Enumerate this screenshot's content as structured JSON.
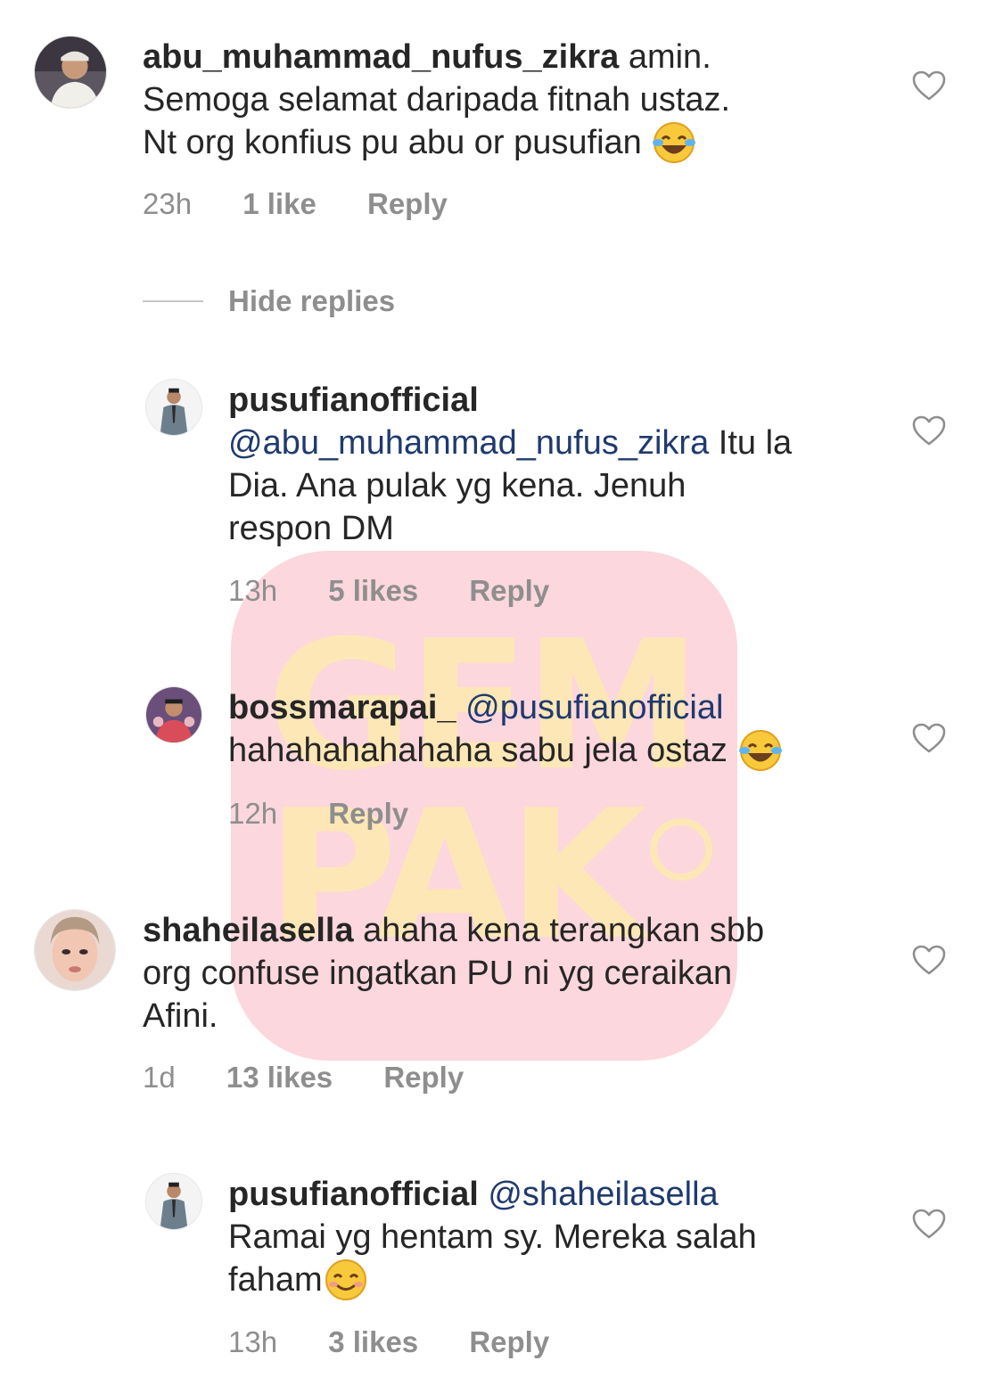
{
  "watermark": {
    "line1": "GEM",
    "line2": "PAK"
  },
  "comments": [
    {
      "username": "abu_muhammad_nufus_zikra",
      "text_line1": "amin.",
      "text_line2": "Semoga selamat daripada fitnah ustaz.",
      "text_line3": "Nt org konfius pu abu or pusufian",
      "emoji": "face-with-tears-of-joy",
      "time": "23h",
      "likes": "1 like",
      "reply_label": "Reply"
    },
    {
      "username": "pusufianofficial",
      "mention": "@abu_muhammad_nufus_zikra",
      "text_line1": " Itu la",
      "text_line2": "Dia. Ana pulak yg kena. Jenuh",
      "text_line3": "respon DM",
      "time": "13h",
      "likes": "5 likes",
      "reply_label": "Reply"
    },
    {
      "username": "bossmarapai_",
      "mention": "@pusufianofficial",
      "text_line2": "hahahahahahaha sabu jela ostaz",
      "emoji": "face-with-tears-of-joy",
      "time": "12h",
      "reply_label": "Reply"
    },
    {
      "username": "shaheilasella",
      "text_line1": "ahaha kena terangkan sbb",
      "text_line2": "org confuse ingatkan PU ni yg ceraikan",
      "text_line3": "Afini.",
      "time": "1d",
      "likes": "13 likes",
      "reply_label": "Reply"
    },
    {
      "username": "pusufianofficial",
      "mention": "@shaheilasella",
      "text_line2": "Ramai yg hentam sy. Mereka salah",
      "text_line3": "faham",
      "emoji": "smiling-face-with-smiling-eyes",
      "time": "13h",
      "likes": "3 likes",
      "reply_label": "Reply"
    }
  ],
  "hide_replies_label": "Hide replies",
  "icons": {
    "like": "heart-outline-icon"
  },
  "colors": {
    "text": "#262626",
    "meta": "#8e8e8e",
    "mention": "#1f3a6e",
    "watermark_bg": "#f7a0af"
  }
}
